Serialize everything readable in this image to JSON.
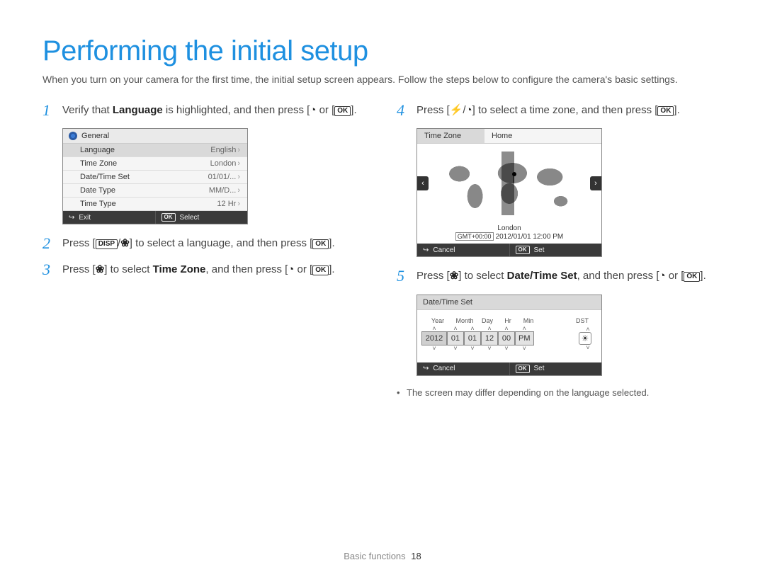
{
  "title": "Performing the initial setup",
  "intro": "When you turn on your camera for the first time, the initial setup screen appears. Follow the steps below to configure the camera's basic settings.",
  "steps": {
    "s1": {
      "num": "1",
      "pre": "Verify that ",
      "bold": "Language",
      "post": " is highlighted, and then press [",
      "tail": "]."
    },
    "s2": {
      "num": "2",
      "pre": "Press [",
      "mid": "] to select a language, and then press [",
      "tail": "]."
    },
    "s3": {
      "num": "3",
      "pre": "Press [",
      "mid": "] to select ",
      "bold": "Time Zone",
      "post": ", and then press [",
      "tail": "]."
    },
    "s4": {
      "num": "4",
      "pre": "Press [",
      "mid": "] to select a time zone, and then press [",
      "tail": "]."
    },
    "s5": {
      "num": "5",
      "pre": "Press [",
      "mid": "] to select ",
      "bold": "Date/Time Set",
      "post": ", and then press [",
      "tail": "]."
    }
  },
  "keys": {
    "disp": "DISP",
    "ok": "OK",
    "flower": "❀",
    "timer": "◔",
    "flash": "⚡",
    "or": " or "
  },
  "generalPanel": {
    "header": "General",
    "rows": [
      {
        "label": "Language",
        "value": "English",
        "hl": true
      },
      {
        "label": "Time Zone",
        "value": "London"
      },
      {
        "label": "Date/Time Set",
        "value": "01/01/..."
      },
      {
        "label": "Date Type",
        "value": "MM/D..."
      },
      {
        "label": "Time Type",
        "value": "12 Hr"
      }
    ],
    "footer": {
      "left": "Exit",
      "right": "Select"
    }
  },
  "tzPanel": {
    "label": "Time Zone",
    "value": "Home",
    "city": "London",
    "gmt": "GMT+00:00",
    "datetime": "2012/01/01  12:00 PM",
    "footer": {
      "left": "Cancel",
      "right": "Set"
    }
  },
  "dtPanel": {
    "header": "Date/Time Set",
    "cols": {
      "year": "Year",
      "month": "Month",
      "day": "Day",
      "hr": "Hr",
      "min": "Min",
      "dst": "DST"
    },
    "vals": {
      "year": "2012",
      "month": "01",
      "day": "01",
      "hr": "12",
      "min": "00",
      "ampm": "PM"
    },
    "footer": {
      "left": "Cancel",
      "right": "Set"
    }
  },
  "note": "The screen may differ depending on the language selected.",
  "footer": {
    "section": "Basic functions",
    "page": "18"
  }
}
